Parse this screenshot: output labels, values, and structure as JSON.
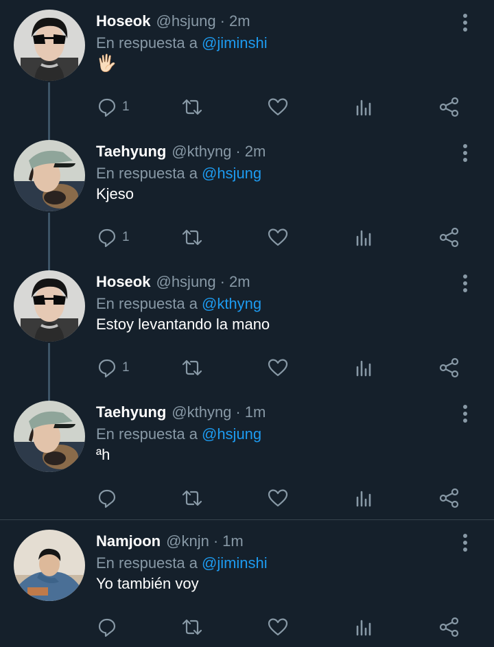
{
  "reply_prefix": "En respuesta a",
  "separator": "·",
  "tweets": [
    {
      "name": "Hoseok",
      "handle": "@hsjung",
      "time": "2m",
      "reply_to": "@jiminshi",
      "text": "🖐🏻",
      "reply_count": "1",
      "avatar": "hoseok"
    },
    {
      "name": "Taehyung",
      "handle": "@kthyng",
      "time": "2m",
      "reply_to": "@hsjung",
      "text": "Kjeso",
      "reply_count": "1",
      "avatar": "taehyung"
    },
    {
      "name": "Hoseok",
      "handle": "@hsjung",
      "time": "2m",
      "reply_to": "@kthyng",
      "text": "Estoy levantando la mano",
      "reply_count": "1",
      "avatar": "hoseok"
    },
    {
      "name": "Taehyung",
      "handle": "@kthyng",
      "time": "1m",
      "reply_to": "@hsjung",
      "text": "ªh",
      "reply_count": "",
      "avatar": "taehyung"
    },
    {
      "name": "Namjoon",
      "handle": "@knjn",
      "time": "1m",
      "reply_to": "@jiminshi",
      "text": "Yo también voy",
      "reply_count": "",
      "avatar": "namjoon"
    }
  ],
  "icons": {
    "reply": "reply-icon",
    "retweet": "retweet-icon",
    "like": "heart-icon",
    "stats": "stats-icon",
    "share": "share-icon",
    "menu": "more-vertical-icon"
  },
  "colors": {
    "background": "#15202b",
    "text": "#ffffff",
    "muted": "#8899a6",
    "accent": "#1d9bf0",
    "thread_line": "#3d5466",
    "divider": "#38444d"
  }
}
